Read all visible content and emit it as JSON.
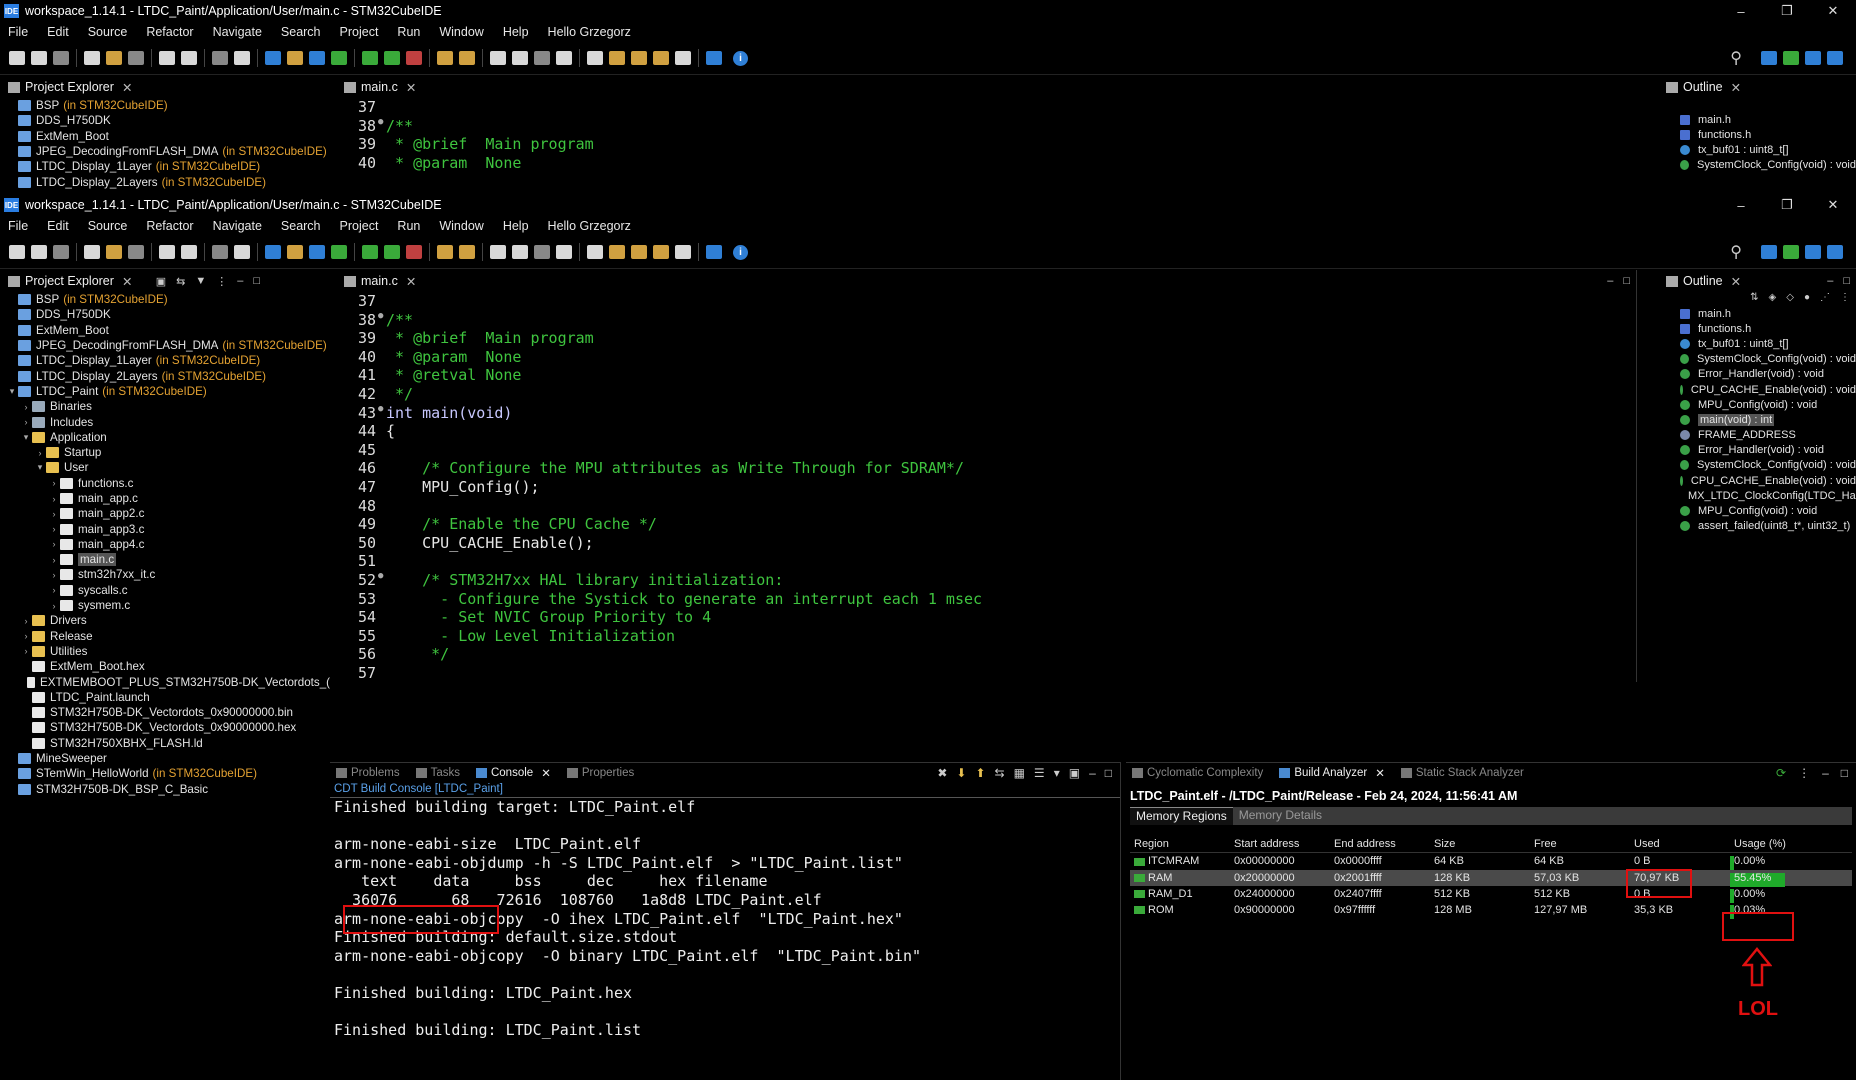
{
  "window": {
    "title": "workspace_1.14.1 - LTDC_Paint/Application/User/main.c - STM32CubeIDE",
    "icon_text": "IDE",
    "controls": [
      "–",
      "❐",
      "✕"
    ]
  },
  "menu": [
    "File",
    "Edit",
    "Source",
    "Refactor",
    "Navigate",
    "Search",
    "Project",
    "Run",
    "Window",
    "Help",
    "Hello Grzegorz"
  ],
  "project_explorer": {
    "tab": "Project Explorer",
    "items": [
      {
        "label": "BSP",
        "note": "(in STM32CubeIDE)",
        "indent": 0,
        "arrow": "",
        "icon": "proj"
      },
      {
        "label": "DDS_H750DK",
        "note": "",
        "indent": 0,
        "arrow": "",
        "icon": "proj"
      },
      {
        "label": "ExtMem_Boot",
        "note": "",
        "indent": 0,
        "arrow": "",
        "icon": "proj"
      },
      {
        "label": "JPEG_DecodingFromFLASH_DMA",
        "note": "(in STM32CubeIDE)",
        "indent": 0,
        "arrow": "",
        "icon": "proj"
      },
      {
        "label": "LTDC_Display_1Layer",
        "note": "(in STM32CubeIDE)",
        "indent": 0,
        "arrow": "",
        "icon": "proj"
      },
      {
        "label": "LTDC_Display_2Layers",
        "note": "(in STM32CubeIDE)",
        "indent": 0,
        "arrow": "",
        "icon": "proj"
      },
      {
        "label": "LTDC_Paint",
        "note": "(in STM32CubeIDE)",
        "indent": 0,
        "arrow": "▾",
        "icon": "proj"
      },
      {
        "label": "Binaries",
        "note": "",
        "indent": 1,
        "arrow": "›",
        "icon": "bin"
      },
      {
        "label": "Includes",
        "note": "",
        "indent": 1,
        "arrow": "›",
        "icon": "bin"
      },
      {
        "label": "Application",
        "note": "",
        "indent": 1,
        "arrow": "▾",
        "icon": "folder"
      },
      {
        "label": "Startup",
        "note": "",
        "indent": 2,
        "arrow": "›",
        "icon": "folder"
      },
      {
        "label": "User",
        "note": "",
        "indent": 2,
        "arrow": "▾",
        "icon": "folder"
      },
      {
        "label": "functions.c",
        "note": "",
        "indent": 3,
        "arrow": "›",
        "icon": "file"
      },
      {
        "label": "main_app.c",
        "note": "",
        "indent": 3,
        "arrow": "›",
        "icon": "file"
      },
      {
        "label": "main_app2.c",
        "note": "",
        "indent": 3,
        "arrow": "›",
        "icon": "file"
      },
      {
        "label": "main_app3.c",
        "note": "",
        "indent": 3,
        "arrow": "›",
        "icon": "file"
      },
      {
        "label": "main_app4.c",
        "note": "",
        "indent": 3,
        "arrow": "›",
        "icon": "file"
      },
      {
        "label": "main.c",
        "note": "",
        "indent": 3,
        "arrow": "›",
        "icon": "file",
        "selected": true
      },
      {
        "label": "stm32h7xx_it.c",
        "note": "",
        "indent": 3,
        "arrow": "›",
        "icon": "file"
      },
      {
        "label": "syscalls.c",
        "note": "",
        "indent": 3,
        "arrow": "›",
        "icon": "file"
      },
      {
        "label": "sysmem.c",
        "note": "",
        "indent": 3,
        "arrow": "›",
        "icon": "file"
      },
      {
        "label": "Drivers",
        "note": "",
        "indent": 1,
        "arrow": "›",
        "icon": "folder"
      },
      {
        "label": "Release",
        "note": "",
        "indent": 1,
        "arrow": "›",
        "icon": "folder"
      },
      {
        "label": "Utilities",
        "note": "",
        "indent": 1,
        "arrow": "›",
        "icon": "folder"
      },
      {
        "label": "ExtMem_Boot.hex",
        "note": "",
        "indent": 1,
        "arrow": "",
        "icon": "file"
      },
      {
        "label": "EXTMEMBOOT_PLUS_STM32H750B-DK_Vectordots_(",
        "note": "",
        "indent": 1,
        "arrow": "",
        "icon": "file"
      },
      {
        "label": "LTDC_Paint.launch",
        "note": "",
        "indent": 1,
        "arrow": "",
        "icon": "file"
      },
      {
        "label": "STM32H750B-DK_Vectordots_0x90000000.bin",
        "note": "",
        "indent": 1,
        "arrow": "",
        "icon": "file"
      },
      {
        "label": "STM32H750B-DK_Vectordots_0x90000000.hex",
        "note": "",
        "indent": 1,
        "arrow": "",
        "icon": "file"
      },
      {
        "label": "STM32H750XBHX_FLASH.ld",
        "note": "",
        "indent": 1,
        "arrow": "",
        "icon": "file"
      },
      {
        "label": "MineSweeper",
        "note": "",
        "indent": 0,
        "arrow": "",
        "icon": "proj"
      },
      {
        "label": "STemWin_HelloWorld",
        "note": "(in STM32CubeIDE)",
        "indent": 0,
        "arrow": "",
        "icon": "proj"
      },
      {
        "label": "STM32H750B-DK_BSP_C_Basic",
        "note": "",
        "indent": 0,
        "arrow": "",
        "icon": "proj"
      }
    ]
  },
  "editor": {
    "tab": "main.c",
    "lines": [
      {
        "n": "37",
        "fold": "",
        "cls": "fn",
        "text": ""
      },
      {
        "n": "38",
        "fold": "●",
        "cls": "cm",
        "text": "/**"
      },
      {
        "n": "39",
        "fold": "",
        "cls": "cm",
        "text": " * @brief  Main program"
      },
      {
        "n": "40",
        "fold": "",
        "cls": "cm",
        "text": " * @param  None"
      },
      {
        "n": "41",
        "fold": "",
        "cls": "cm",
        "text": " * @retval None"
      },
      {
        "n": "42",
        "fold": "",
        "cls": "cm",
        "text": " */"
      },
      {
        "n": "43",
        "fold": "●",
        "cls": "kw",
        "text": "int main(void)"
      },
      {
        "n": "44",
        "fold": "",
        "cls": "fn",
        "text": "{"
      },
      {
        "n": "45",
        "fold": "",
        "cls": "fn",
        "text": ""
      },
      {
        "n": "46",
        "fold": "",
        "cls": "cm",
        "text": "    /* Configure the MPU attributes as Write Through for SDRAM*/"
      },
      {
        "n": "47",
        "fold": "",
        "cls": "fn",
        "text": "    MPU_Config();"
      },
      {
        "n": "48",
        "fold": "",
        "cls": "fn",
        "text": ""
      },
      {
        "n": "49",
        "fold": "",
        "cls": "cm",
        "text": "    /* Enable the CPU Cache */"
      },
      {
        "n": "50",
        "fold": "",
        "cls": "fn",
        "text": "    CPU_CACHE_Enable();"
      },
      {
        "n": "51",
        "fold": "",
        "cls": "fn",
        "text": ""
      },
      {
        "n": "52",
        "fold": "●",
        "cls": "cm",
        "text": "    /* STM32H7xx HAL library initialization:"
      },
      {
        "n": "53",
        "fold": "",
        "cls": "cm",
        "text": "      - Configure the Systick to generate an interrupt each 1 msec"
      },
      {
        "n": "54",
        "fold": "",
        "cls": "cm",
        "text": "      - Set NVIC Group Priority to 4"
      },
      {
        "n": "55",
        "fold": "",
        "cls": "cm",
        "text": "      - Low Level Initialization"
      },
      {
        "n": "56",
        "fold": "",
        "cls": "cm",
        "text": "     */"
      },
      {
        "n": "57",
        "fold": "",
        "cls": "fn",
        "text": ""
      }
    ]
  },
  "outline": {
    "tab": "Outline",
    "items": [
      {
        "label": "main.h",
        "icon": "h"
      },
      {
        "label": "functions.h",
        "icon": "h"
      },
      {
        "label": "tx_buf01 : uint8_t[]",
        "icon": "var"
      },
      {
        "label": "SystemClock_Config(void) : void",
        "icon": "fn"
      },
      {
        "label": "Error_Handler(void) : void",
        "icon": "fn"
      },
      {
        "label": "CPU_CACHE_Enable(void) : void",
        "icon": "fn"
      },
      {
        "label": "MPU_Config(void) : void",
        "icon": "fn"
      },
      {
        "label": "main(void) : int",
        "icon": "fn",
        "selected": true
      },
      {
        "label": "FRAME_ADDRESS",
        "icon": "def"
      },
      {
        "label": "Error_Handler(void) : void",
        "icon": "fn"
      },
      {
        "label": "SystemClock_Config(void) : void",
        "icon": "fn"
      },
      {
        "label": "CPU_CACHE_Enable(void) : void",
        "icon": "fn"
      },
      {
        "label": "MX_LTDC_ClockConfig(LTDC_Handle",
        "icon": "fn"
      },
      {
        "label": "MPU_Config(void) : void",
        "icon": "fn"
      },
      {
        "label": "assert_failed(uint8_t*, uint32_t)",
        "icon": "fn"
      }
    ]
  },
  "console": {
    "tabs": [
      "Problems",
      "Tasks",
      "Console",
      "Properties"
    ],
    "active": "Console",
    "subtitle": "CDT Build Console [LTDC_Paint]",
    "lines": [
      "Finished building target: LTDC_Paint.elf",
      "",
      "arm-none-eabi-size  LTDC_Paint.elf",
      "arm-none-eabi-objdump -h -S LTDC_Paint.elf  > \"LTDC_Paint.list\"",
      "   text    data     bss     dec     hex filename",
      "  36076      68   72616  108760   1a8d8 LTDC_Paint.elf",
      "arm-none-eabi-objcopy  -O ihex LTDC_Paint.elf  \"LTDC_Paint.hex\"",
      "Finished building: default.size.stdout",
      "arm-none-eabi-objcopy  -O binary LTDC_Paint.elf  \"LTDC_Paint.bin\"",
      "",
      "Finished building: LTDC_Paint.hex",
      "",
      "Finished building: LTDC_Paint.list"
    ]
  },
  "build_analyzer": {
    "tabs": [
      "Cyclomatic Complexity",
      "Build Analyzer",
      "Static Stack Analyzer"
    ],
    "active": "Build Analyzer",
    "header": "LTDC_Paint.elf - /LTDC_Paint/Release - Feb 24, 2024, 11:56:41 AM",
    "subtabs": [
      "Memory Regions",
      "Memory Details"
    ],
    "columns": [
      "Region",
      "Start address",
      "End address",
      "Size",
      "Free",
      "Used",
      "Usage (%)"
    ],
    "rows": [
      {
        "region": "ITCMRAM",
        "start": "0x00000000",
        "end": "0x0000ffff",
        "size": "64 KB",
        "free": "64 KB",
        "used": "0 B",
        "usage": "0.00%",
        "usage_fraction": 0
      },
      {
        "region": "RAM",
        "start": "0x20000000",
        "end": "0x2001ffff",
        "size": "128 KB",
        "free": "57,03 KB",
        "used": "70,97 KB",
        "usage": "55.45%",
        "usage_fraction": 0.5545,
        "selected": true
      },
      {
        "region": "RAM_D1",
        "start": "0x24000000",
        "end": "0x2407ffff",
        "size": "512 KB",
        "free": "512 KB",
        "used": "0 B",
        "usage": "0.00%",
        "usage_fraction": 0
      },
      {
        "region": "ROM",
        "start": "0x90000000",
        "end": "0x97ffffff",
        "size": "128 MB",
        "free": "127,97 MB",
        "used": "35,3 KB",
        "usage": "0.03%",
        "usage_fraction": 0.0003
      }
    ],
    "bar_color": "#1faa2a"
  },
  "annotation": {
    "text": "LOL",
    "color": "#e01010"
  }
}
